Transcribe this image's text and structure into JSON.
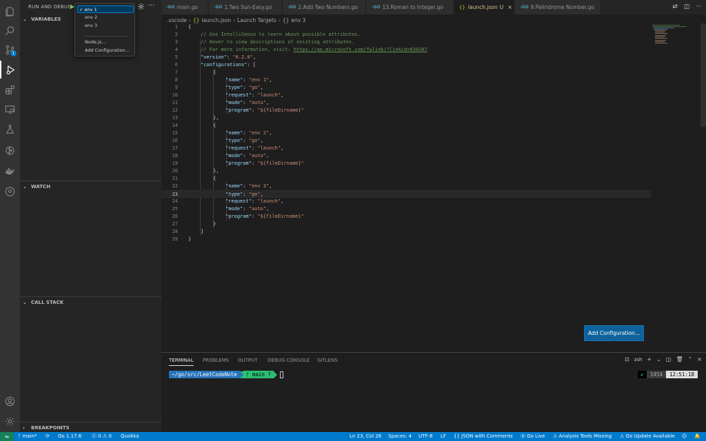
{
  "sidebar": {
    "title": "RUN AND DEBUG",
    "sections": {
      "variables": "VARIABLES",
      "watch": "WATCH",
      "call_stack": "CALL STACK",
      "breakpoints": "BREAKPOINTS"
    }
  },
  "dropdown": {
    "items": [
      "env 1",
      "env 2",
      "env 3"
    ],
    "selected_mark": "✓",
    "extra": [
      "Node.js...",
      "Add Configuration..."
    ]
  },
  "activity": {
    "badge": "1"
  },
  "tabs": [
    {
      "icon": "-GO",
      "label": "main.go"
    },
    {
      "icon": "-GO",
      "label": "1.Two Sun-Easy.go"
    },
    {
      "icon": "-GO",
      "label": "2.Add Two Numbers.go"
    },
    {
      "icon": "-GO",
      "label": "13.Roman to Integer.go"
    },
    {
      "icon": "{}",
      "label": "launch.json",
      "status": "U",
      "close": "×"
    },
    {
      "icon": "-GO",
      "label": "9.Palindrome Number.go"
    }
  ],
  "breadcrumb": [
    ".vscode",
    "launch.json",
    "Launch Targets",
    "env 3"
  ],
  "editor": {
    "line_numbers": [
      "1",
      "2",
      "3",
      "4",
      "5",
      "6",
      "7",
      "8",
      "9",
      "10",
      "11",
      "12",
      "13",
      "14",
      "15",
      "16",
      "17",
      "18",
      "19",
      "20",
      "21",
      "22",
      "23",
      "24",
      "25",
      "26",
      "27",
      "28",
      "29"
    ],
    "comments": [
      "// Use IntelliSense to learn about possible attributes.",
      "// Hover to view descriptions of existing attributes.",
      "// For more information, visit: "
    ],
    "link": "https://go.microsoft.com/fwlink/?linkid=830387",
    "version_key": "\"version\"",
    "version_val": "\"0.2.0\"",
    "configurations_key": "\"configurations\"",
    "configs": [
      {
        "name": "\"env 1\"",
        "type": "\"go\"",
        "request": "\"launch\"",
        "mode": "\"auto\"",
        "program": "\"${fileDirname}\""
      },
      {
        "name": "\"env 2\"",
        "type": "\"go\"",
        "request": "\"launch\"",
        "mode": "\"auto\"",
        "program": "\"${fileDirname}\""
      },
      {
        "name": "\"env 3\"",
        "type": "\"go\"",
        "request": "\"launch\"",
        "mode": "\"auto\"",
        "program": "\"${fileDirname}\""
      }
    ],
    "keys": {
      "name": "\"name\"",
      "type": "\"type\"",
      "request": "\"request\"",
      "mode": "\"mode\"",
      "program": "\"program\""
    }
  },
  "add_config_button": "Add Configuration...",
  "panel": {
    "tabs": [
      "TERMINAL",
      "PROBLEMS",
      "OUTPUT",
      "DEBUG CONSOLE",
      "GITLENS"
    ],
    "shell": "zsh",
    "prompt_path": "~/go/src/LeetCodeNote",
    "prompt_branch": " main ?",
    "right_count": "1454",
    "right_time": "12:51:18"
  },
  "status": {
    "branch": "main*",
    "go_version": "Go 1.17.6",
    "errors": "0",
    "warnings": "0",
    "quokka": "Quokka",
    "position": "Ln 23, Col 26",
    "spaces": "Spaces: 4",
    "encoding": "UTF-8",
    "eol": "LF",
    "language": "JSON with Comments",
    "go_live": "Go Live",
    "analysis": "Analysis Tools Missing",
    "go_update": "Go Update Available"
  }
}
